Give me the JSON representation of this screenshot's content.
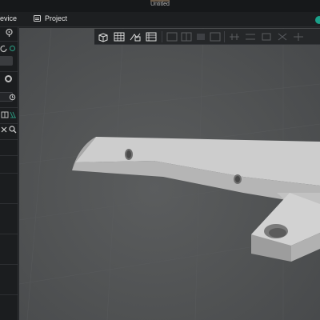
{
  "window": {
    "title": "Untitled"
  },
  "menubar": {
    "tabs": [
      {
        "label": "evice",
        "icon": "device"
      },
      {
        "label": "Project",
        "icon": "project-icon"
      }
    ],
    "status_color": "#1aa089"
  },
  "sidebar": {
    "icons": [
      "target-icon",
      "refresh-icon",
      "gear-icon",
      "clock-icon",
      "split-view-icon",
      "close-icon",
      "search-icon"
    ]
  },
  "toolbar": {
    "buttons": [
      "add-object-icon",
      "grid-table-icon",
      "move-icon",
      "layers-icon",
      "align-icon",
      "align-center-icon",
      "align-right-icon",
      "align-bottom-icon",
      "arrange-icon",
      "arrange-2-icon",
      "arrange-3-icon",
      "arrange-4-icon",
      "arrange-5-icon"
    ]
  },
  "viewport": {
    "background": "#505253",
    "part_color": "#c9c9c9"
  }
}
